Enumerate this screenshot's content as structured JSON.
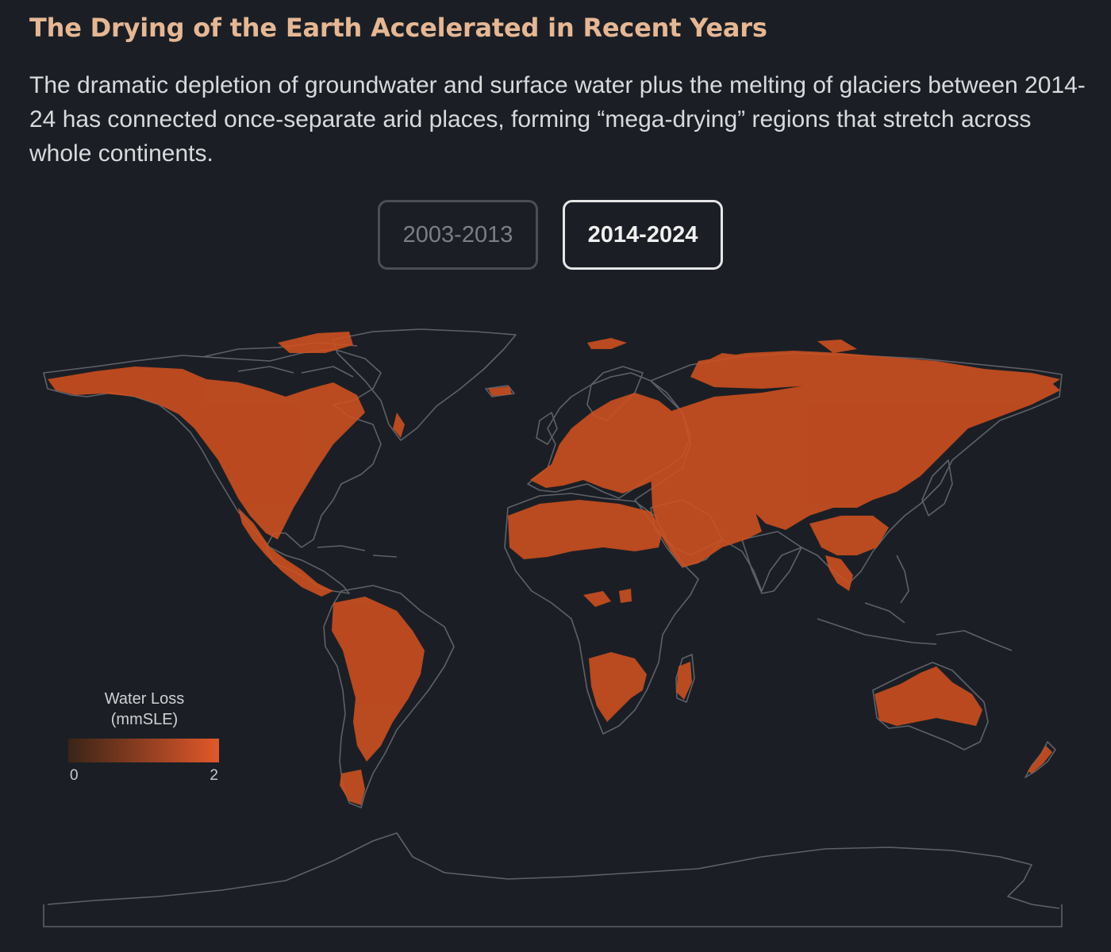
{
  "header": {
    "title": "The Drying of the Earth Accelerated in Recent Years",
    "subtitle": "The dramatic depletion of groundwater and surface water plus the melting of glaciers between 2014-24 has connected once-separate arid places, forming “mega-drying” regions that stretch across whole continents."
  },
  "toggles": [
    {
      "label": "2003-2013",
      "selected": false
    },
    {
      "label": "2014-2024",
      "selected": true
    }
  ],
  "legend": {
    "title_line1": "Water Loss",
    "title_line2": "(mmSLE)",
    "min_label": "0",
    "max_label": "2",
    "color_low": "#3a2418",
    "color_high": "#e2582a"
  },
  "colors": {
    "background": "#1b1f25",
    "title": "#e6b794",
    "coastline": "#5d6168",
    "drying": "#d0501f"
  }
}
